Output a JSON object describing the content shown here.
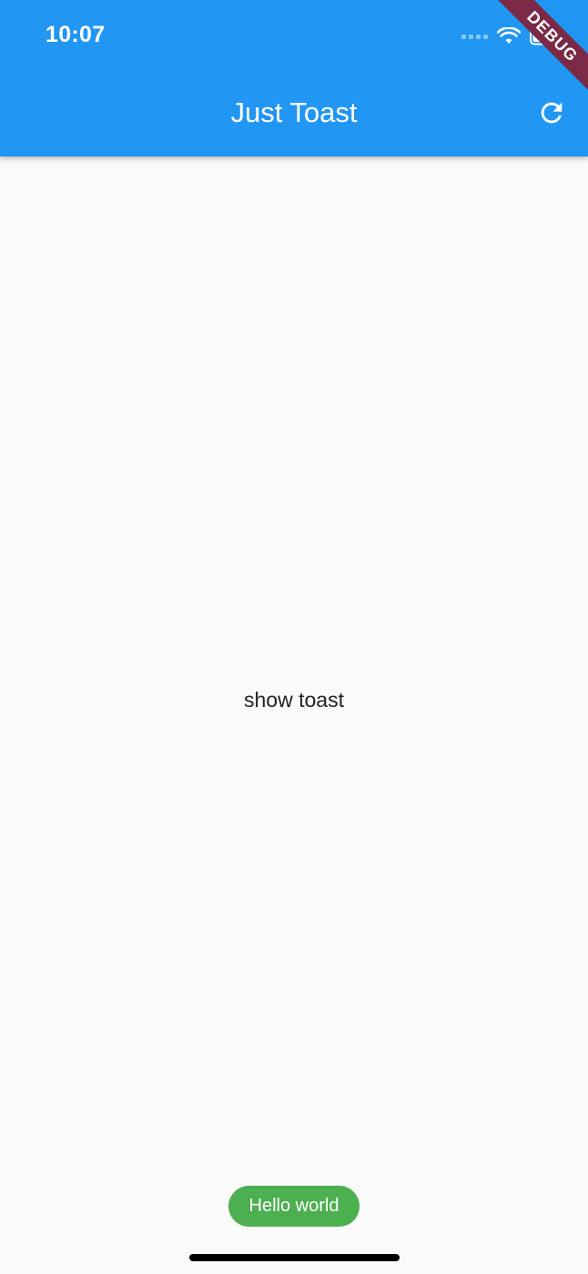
{
  "status_bar": {
    "time": "10:07",
    "icons": [
      "signal-icon",
      "wifi-icon",
      "battery-icon"
    ]
  },
  "app_bar": {
    "title": "Just Toast",
    "action_icon": "refresh-icon",
    "color": "#2196f3"
  },
  "debug_banner": {
    "label": "DEBUG",
    "color": "#7a2a46"
  },
  "main": {
    "button_label": "show toast"
  },
  "toast": {
    "message": "Hello world",
    "color": "#4caf50"
  }
}
